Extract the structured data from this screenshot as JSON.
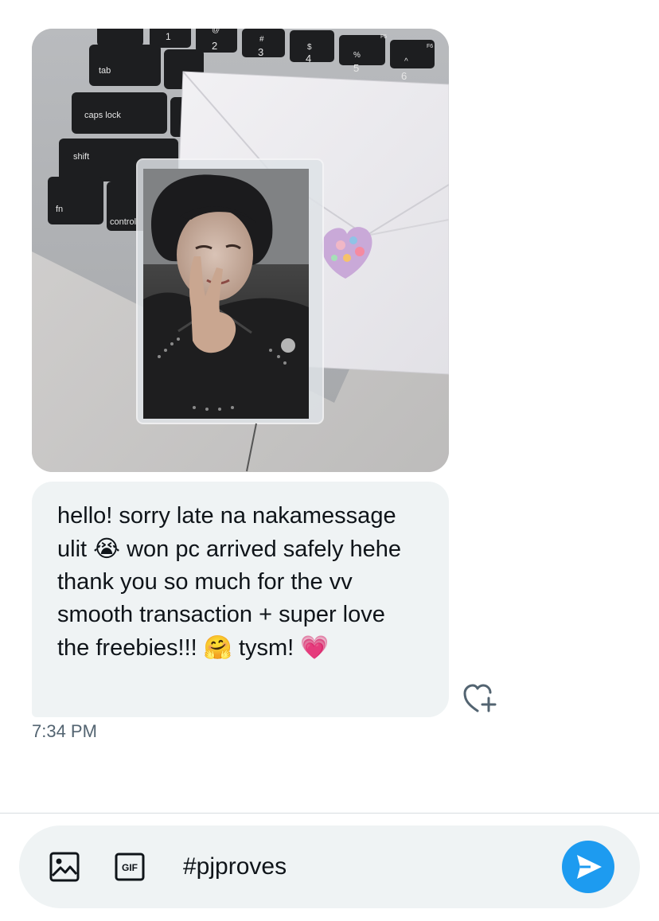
{
  "message": {
    "text_parts": [
      "hello! sorry late na nakamessage ulit ",
      "😭",
      " won pc arrived safely hehe thank you so much for the vv smooth transaction + super love the freebies!!! ",
      "🤗",
      " tysm! ",
      "💗"
    ],
    "timestamp": "7:34 PM"
  },
  "photo": {
    "keys": {
      "tab": "tab",
      "caps": "caps lock",
      "shift": "shift",
      "fn": "fn",
      "control": "control",
      "n1": "1",
      "n2": "2",
      "n3": "3",
      "n4": "4",
      "n5": "5",
      "n6": "6",
      "s2": "@",
      "s3": "#",
      "s4": "$",
      "s5": "%",
      "s6": "^",
      "f5": "F5",
      "f6": "F6"
    }
  },
  "composer": {
    "value": "#pjproves",
    "send_color": "#1d9bf0"
  },
  "icons": {
    "react": "heart-plus-icon",
    "image": "image-icon",
    "gif": "gif-icon",
    "send": "send-icon"
  },
  "labels": {
    "gif": "GIF"
  }
}
